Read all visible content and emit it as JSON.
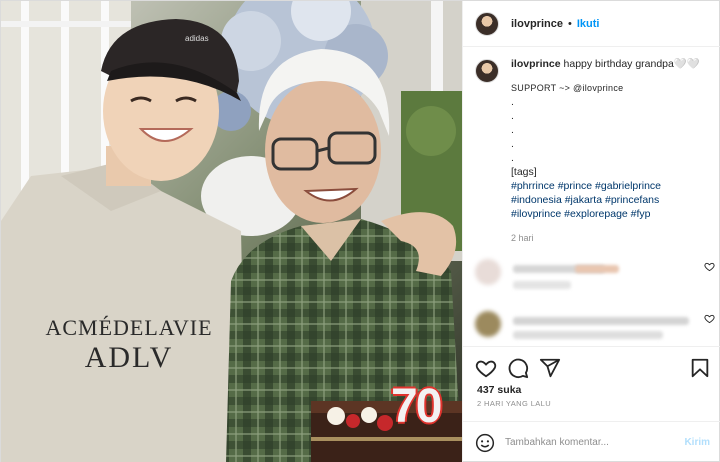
{
  "header": {
    "username": "ilovprince",
    "separator": "•",
    "follow_label": "Ikuti"
  },
  "caption": {
    "username": "ilovprince",
    "text": "happy birthday grandpa🤍🤍",
    "lines": [
      "SUPPORT ~> @ilovprince",
      ".",
      ".",
      ".",
      ".",
      ".",
      "[tags]"
    ],
    "hashtags": [
      "#phrrince #prince #gabrielprince",
      "#indonesia #jakarta #princefans",
      "#ilovprince #explorepage #fyp"
    ],
    "time": "2 hari"
  },
  "photo": {
    "hoodie_line1": "ACMÉDELAVIE",
    "hoodie_line2": "ADLV",
    "cap_brand": "adidas",
    "candle_number": "70"
  },
  "icons": {
    "like": "heart-icon",
    "comment": "comment-icon",
    "share": "send-icon",
    "save": "bookmark-icon",
    "emoji": "emoji-icon"
  },
  "stats": {
    "likes": "437 suka",
    "posted": "2 HARI YANG LALU"
  },
  "comment_box": {
    "placeholder": "Tambahkan komentar...",
    "post_label": "Kirim"
  },
  "colors": {
    "link": "#00376b",
    "accent": "#0095f6",
    "post_disabled": "#b2dffc",
    "muted": "#8e8e8e"
  }
}
